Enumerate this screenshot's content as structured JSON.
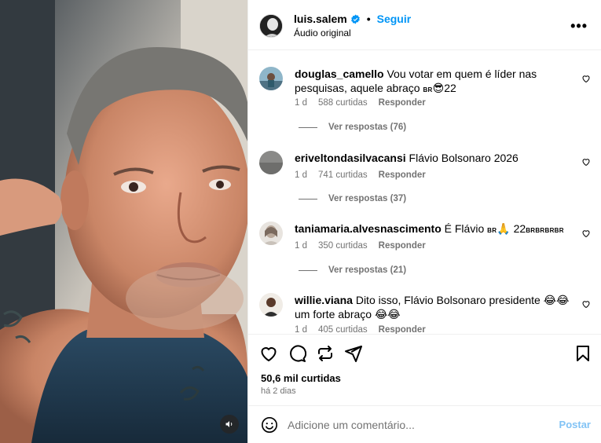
{
  "header": {
    "username": "luis.salem",
    "separator": "•",
    "follow_label": "Seguir",
    "audio_label": "Áudio original",
    "more_label": "•••"
  },
  "comments": [
    {
      "username": "douglas_camello",
      "text_before": "Vou votar em quem é líder nas pesquisas, aquele abraço ",
      "flag": "BR",
      "emoji": "😎",
      "text_after": "22",
      "age": "1 d",
      "likes": "588 curtidas",
      "reply_label": "Responder",
      "view_replies": "Ver respostas (76)"
    },
    {
      "username": "eriveltondasilvacansi",
      "text": "Flávio Bolsonaro 2026",
      "age": "1 d",
      "likes": "741 curtidas",
      "reply_label": "Responder",
      "view_replies": "Ver respostas (37)"
    },
    {
      "username": "taniamaria.alvesnascimento",
      "text_before": "É Flávio ",
      "flag": "BR",
      "emoji": "🙏",
      "text_after": " 22",
      "flags_tail": "BRBRBRBR",
      "age": "1 d",
      "likes": "350 curtidas",
      "reply_label": "Responder",
      "view_replies": "Ver respostas (21)"
    },
    {
      "username": "willie.viana",
      "text": "Dito isso, Flávio Bolsonaro presidente 😂😂 um forte abraço 😂😂",
      "age": "1 d",
      "likes": "405 curtidas",
      "reply_label": "Responder"
    }
  ],
  "actions": {
    "likes_count": "50,6 mil curtidas",
    "posted_ago": "há 2 dias"
  },
  "composer": {
    "placeholder": "Adicione um comentário...",
    "post_label": "Postar"
  },
  "icons": [
    "sound-icon",
    "verified-icon",
    "more-icon",
    "heart-icon",
    "comment-icon",
    "share-icon",
    "send-icon",
    "save-icon",
    "emoji-icon"
  ],
  "colors": {
    "accent": "#0095f6",
    "muted": "#737373",
    "post_disabled": "#82c3f5"
  }
}
